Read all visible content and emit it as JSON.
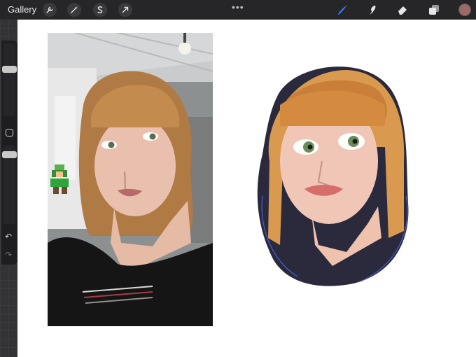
{
  "topbar": {
    "gallery_label": "Gallery",
    "left_tools": [
      "wrench-icon",
      "magic-wand-icon",
      "selection-icon",
      "transform-arrow-icon"
    ],
    "more_label": "•••",
    "right_tools": [
      "brush-icon",
      "smudge-icon",
      "eraser-icon",
      "layers-icon"
    ],
    "active_tool": "brush-icon",
    "current_color": "#9c6a66"
  },
  "sidebar": {
    "controls": [
      "brush-size-slider",
      "modify-button",
      "opacity-slider",
      "undo-icon",
      "redo-icon"
    ]
  },
  "colors": {
    "accent": "#2f80ff",
    "toolbar_bg": "#262628",
    "canvas_bg": "#ffffff"
  }
}
